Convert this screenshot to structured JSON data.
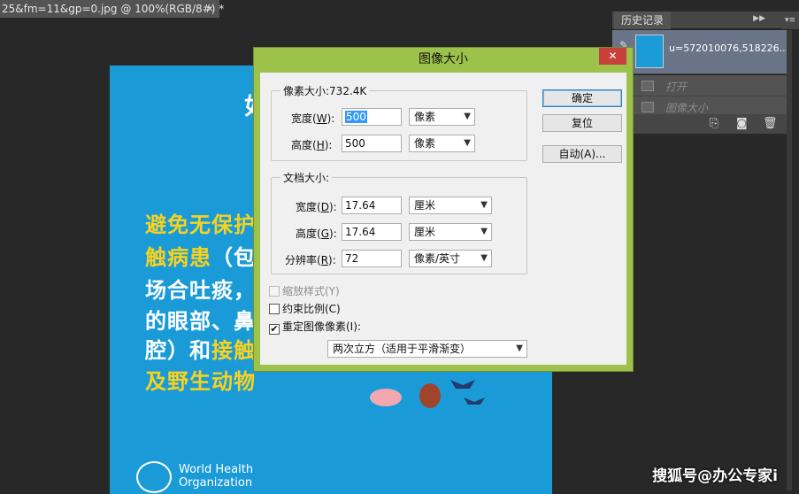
{
  "document_tab": {
    "title": "25&fm=11&gp=0.jpg @ 100%(RGB/8#) *",
    "close": "×"
  },
  "poster": {
    "partial_title": "如",
    "lines": [
      {
        "parts": [
          {
            "text": "避免无保护",
            "color": "yellow"
          }
        ]
      },
      {
        "parts": [
          {
            "text": "触病患",
            "color": "yellow"
          },
          {
            "text": "（包",
            "color": "white"
          }
        ]
      },
      {
        "parts": [
          {
            "text": "场合吐痰，",
            "color": "white"
          }
        ]
      },
      {
        "parts": [
          {
            "text": "的眼部、鼻",
            "color": "white"
          }
        ]
      },
      {
        "parts": [
          {
            "text": "腔）和",
            "color": "white"
          },
          {
            "text": "接触",
            "color": "yellow"
          }
        ]
      },
      {
        "parts": [
          {
            "text": "及野生动物",
            "color": "yellow"
          }
        ]
      }
    ],
    "org_line1": "World Health",
    "org_line2": "Organization"
  },
  "history_panel": {
    "tab": "历史记录",
    "snapshot_name": "u=572010076,518226...",
    "items": [
      "打开",
      "图像大小"
    ]
  },
  "dialog": {
    "title": "图像大小",
    "close": "✕",
    "pixel_dims": {
      "legend": "像素大小:732.4K",
      "width_label": "宽度(",
      "width_key": "W",
      "height_label": "高度(",
      "height_key": "H",
      "label_end": "):",
      "width": "500",
      "height": "500",
      "width_unit": "像素",
      "height_unit": "像素"
    },
    "doc_size": {
      "legend": "文档大小:",
      "width_label": "宽度(",
      "width_key": "D",
      "height_label": "高度(",
      "height_key": "G",
      "res_label": "分辨率(",
      "res_key": "R",
      "label_end": "):",
      "width": "17.64",
      "height": "17.64",
      "resolution": "72",
      "width_unit": "厘米",
      "height_unit": "厘米",
      "res_unit": "像素/英寸"
    },
    "buttons": {
      "ok": "确定",
      "reset": "复位",
      "auto": "自动(A)..."
    },
    "checkboxes": {
      "scale_styles": "缩放样式(Y)",
      "constrain": "约束比例(C)",
      "resample": "重定图像像素(I):"
    },
    "checks": {
      "scale_styles": "",
      "constrain": "",
      "resample": "✔"
    },
    "resample_method": "两次立方（适用于平滑渐变）"
  },
  "watermark": "搜狐号@办公专家i",
  "colors": {
    "poster_bg": "#1a9bd8",
    "dialog_frame": "#9dc24b",
    "accent_yellow": "#f7d21e"
  }
}
